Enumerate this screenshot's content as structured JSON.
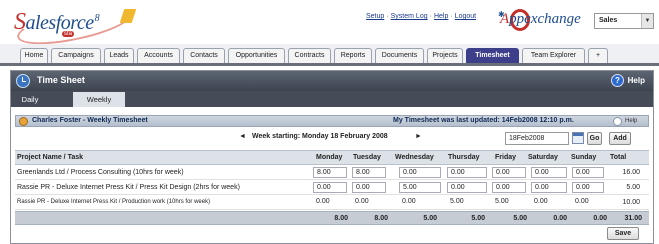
{
  "header": {
    "logo_text_s": "S",
    "logo_text_rest": "alesforce",
    "logo_version": "8",
    "logo_badge": "sfa",
    "links": [
      "Setup",
      "System Log",
      "Help",
      "Logout"
    ],
    "appexchange_text_a": "A",
    "appexchange_text_rest": "ppexchange",
    "app_selector": "Sales"
  },
  "tabs": [
    {
      "label": "Home",
      "active": false
    },
    {
      "label": "Campaigns",
      "active": false
    },
    {
      "label": "Leads",
      "active": false
    },
    {
      "label": "Accounts",
      "active": false
    },
    {
      "label": "Contacts",
      "active": false
    },
    {
      "label": "Opportunities",
      "active": false
    },
    {
      "label": "Contracts",
      "active": false
    },
    {
      "label": "Reports",
      "active": false
    },
    {
      "label": "Documents",
      "active": false
    },
    {
      "label": "Projects",
      "active": false
    },
    {
      "label": "Timesheet",
      "active": true
    },
    {
      "label": "Team Explorer",
      "active": false
    },
    {
      "label": "+",
      "active": false
    }
  ],
  "timesheet": {
    "title": "Time Sheet",
    "help": "Help",
    "subtabs": [
      {
        "label": "Daily",
        "selected": false
      },
      {
        "label": "Weekly",
        "selected": true
      }
    ],
    "weekly_title": "Charles Foster - Weekly Timesheet",
    "last_updated": "My Timesheet was last updated: 14Feb2008 12:10 p.m.",
    "mini_help": "Help",
    "week_label": "Week starting: Monday 18 February 2008",
    "prev_arrow": "◄",
    "next_arrow": "►",
    "date_value": "18Feb2008",
    "go_label": "Go",
    "add_label": "Add",
    "save_label": "Save"
  },
  "table": {
    "columns": [
      "Project Name / Task",
      "Monday",
      "Tuesday",
      "Wednesday",
      "Thursday",
      "Friday",
      "Saturday",
      "Sunday",
      "Total"
    ],
    "rows": [
      {
        "task": "Greenlands Ltd / Process Consulting (10hrs for week)",
        "values": [
          "8.00",
          "8.00",
          "0.00",
          "0.00",
          "0.00",
          "0.00",
          "0.00"
        ],
        "total": "16.00"
      },
      {
        "task": "Rassie PR - Deluxe Internet Press Kit / Press Kit Design (2hrs for week)",
        "values": [
          "0.00",
          "0.00",
          "5.00",
          "0.00",
          "0.00",
          "0.00",
          "0.00"
        ],
        "total": "5.00"
      },
      {
        "task": "Rassie PR - Deluxe Internet Press Kit / Production work (10hrs for week)",
        "values": [
          "0.00",
          "0.00",
          "0.00",
          "5.00",
          "5.00",
          "0.00",
          "0.00"
        ],
        "total": "10.00"
      }
    ],
    "footer": [
      "8.00",
      "8.00",
      "5.00",
      "5.00",
      "5.00",
      "0.00",
      "0.00",
      "31.00"
    ]
  },
  "colors": {
    "active_tab": "#3d3f8a",
    "title_bar": "#4a515c",
    "help_icon": "#2e6bd1",
    "brand_red": "#c4302b",
    "brand_blue": "#1f4e8c"
  }
}
